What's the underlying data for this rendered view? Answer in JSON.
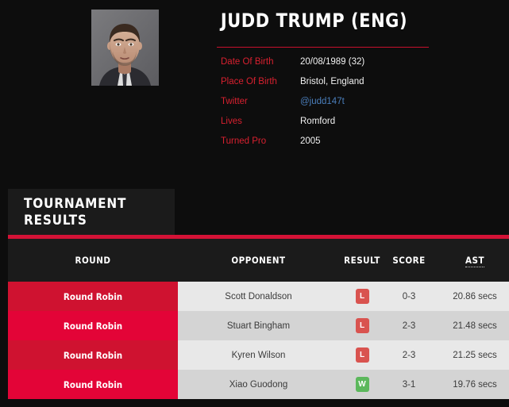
{
  "player": {
    "title": "JUDD TRUMP (ENG)",
    "photo_alt": "player-portrait",
    "info": [
      {
        "label": "Date Of Birth",
        "value": "20/08/1989 (32)",
        "link": false
      },
      {
        "label": "Place Of Birth",
        "value": "Bristol, England",
        "link": false
      },
      {
        "label": "Twitter",
        "value": "@judd147t",
        "link": true
      },
      {
        "label": "Lives",
        "value": "Romford",
        "link": false
      },
      {
        "label": "Turned Pro",
        "value": "2005",
        "link": false
      }
    ]
  },
  "section": {
    "heading": "TOURNAMENT RESULTS"
  },
  "results": {
    "columns": [
      "ROUND",
      "OPPONENT",
      "RESULT",
      "SCORE",
      "AST"
    ],
    "rows": [
      {
        "round": "Round Robin",
        "opponent": "Scott Donaldson",
        "result": "L",
        "score": "0-3",
        "ast": "20.86 secs"
      },
      {
        "round": "Round Robin",
        "opponent": "Stuart Bingham",
        "result": "L",
        "score": "2-3",
        "ast": "21.48 secs"
      },
      {
        "round": "Round Robin",
        "opponent": "Kyren Wilson",
        "result": "L",
        "score": "2-3",
        "ast": "21.25 secs"
      },
      {
        "round": "Round Robin",
        "opponent": "Xiao Guodong",
        "result": "W",
        "score": "3-1",
        "ast": "19.76 secs"
      }
    ]
  },
  "colors": {
    "accent_red": "#d41236",
    "label_red": "#d8202f",
    "row_red_dark": "#cf1230",
    "row_red_bright": "#e30437",
    "link_blue": "#4a7ebb",
    "badge_loss": "#d9534f",
    "badge_win": "#5cb85c",
    "page_bg": "#0d0d0d",
    "panel_bg": "#1b1b1b"
  }
}
